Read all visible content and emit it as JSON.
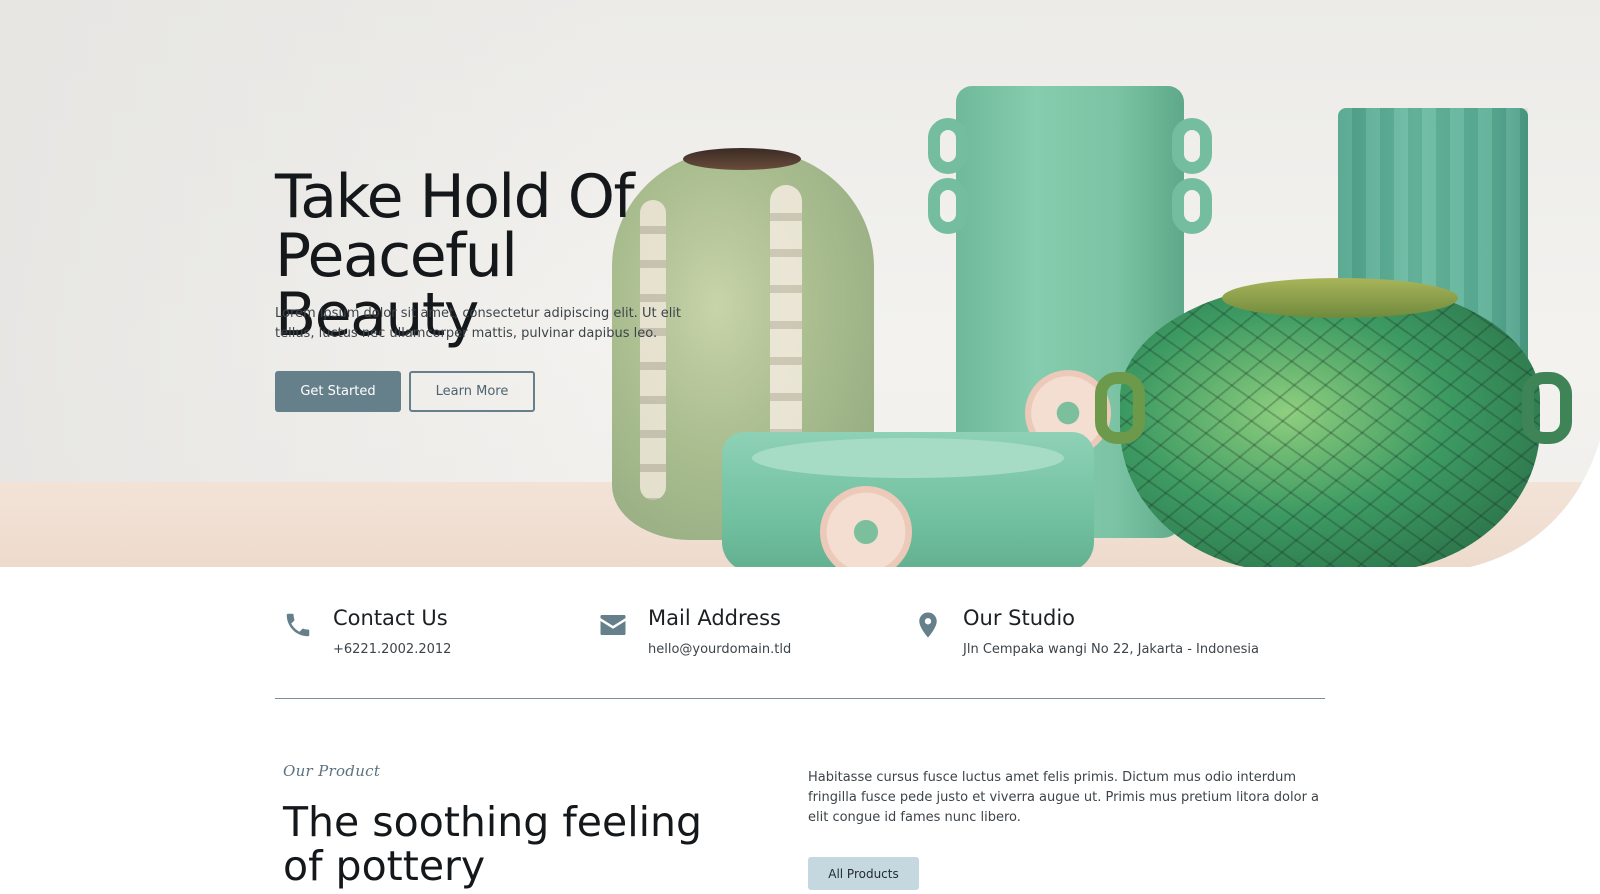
{
  "hero": {
    "title_line1": "Take Hold Of",
    "title_line2": "Peaceful Beauty",
    "text": "Lorem ipsum dolor sit amet, consectetur adipiscing elit. Ut elit tellus, luctus nec ullamcorper mattis, pulvinar dapibus leo.",
    "primary_button": "Get Started",
    "secondary_button": "Learn More"
  },
  "contact": {
    "phone": {
      "icon": "phone-icon",
      "title": "Contact Us",
      "value": "+6221.2002.2012"
    },
    "mail": {
      "icon": "envelope-icon",
      "title": "Mail Address",
      "value": "hello@yourdomain.tld"
    },
    "studio": {
      "icon": "map-pin-icon",
      "title": "Our Studio",
      "value": "Jln Cempaka wangi No 22, Jakarta - Indonesia"
    }
  },
  "product": {
    "eyebrow": "Our Product",
    "title_line1": "The soothing feeling",
    "title_line2": "of pottery",
    "text": "Habitasse cursus fusce luctus amet felis primis. Dictum mus odio interdum fringilla fusce pede justo et viverra augue ut. Primis mus pretium litora dolor a elit congue id fames nunc libero.",
    "button": "All Products"
  },
  "colors": {
    "accent": "#657f8b",
    "accent_light": "#c6d8df",
    "text_dark": "#14181b"
  }
}
